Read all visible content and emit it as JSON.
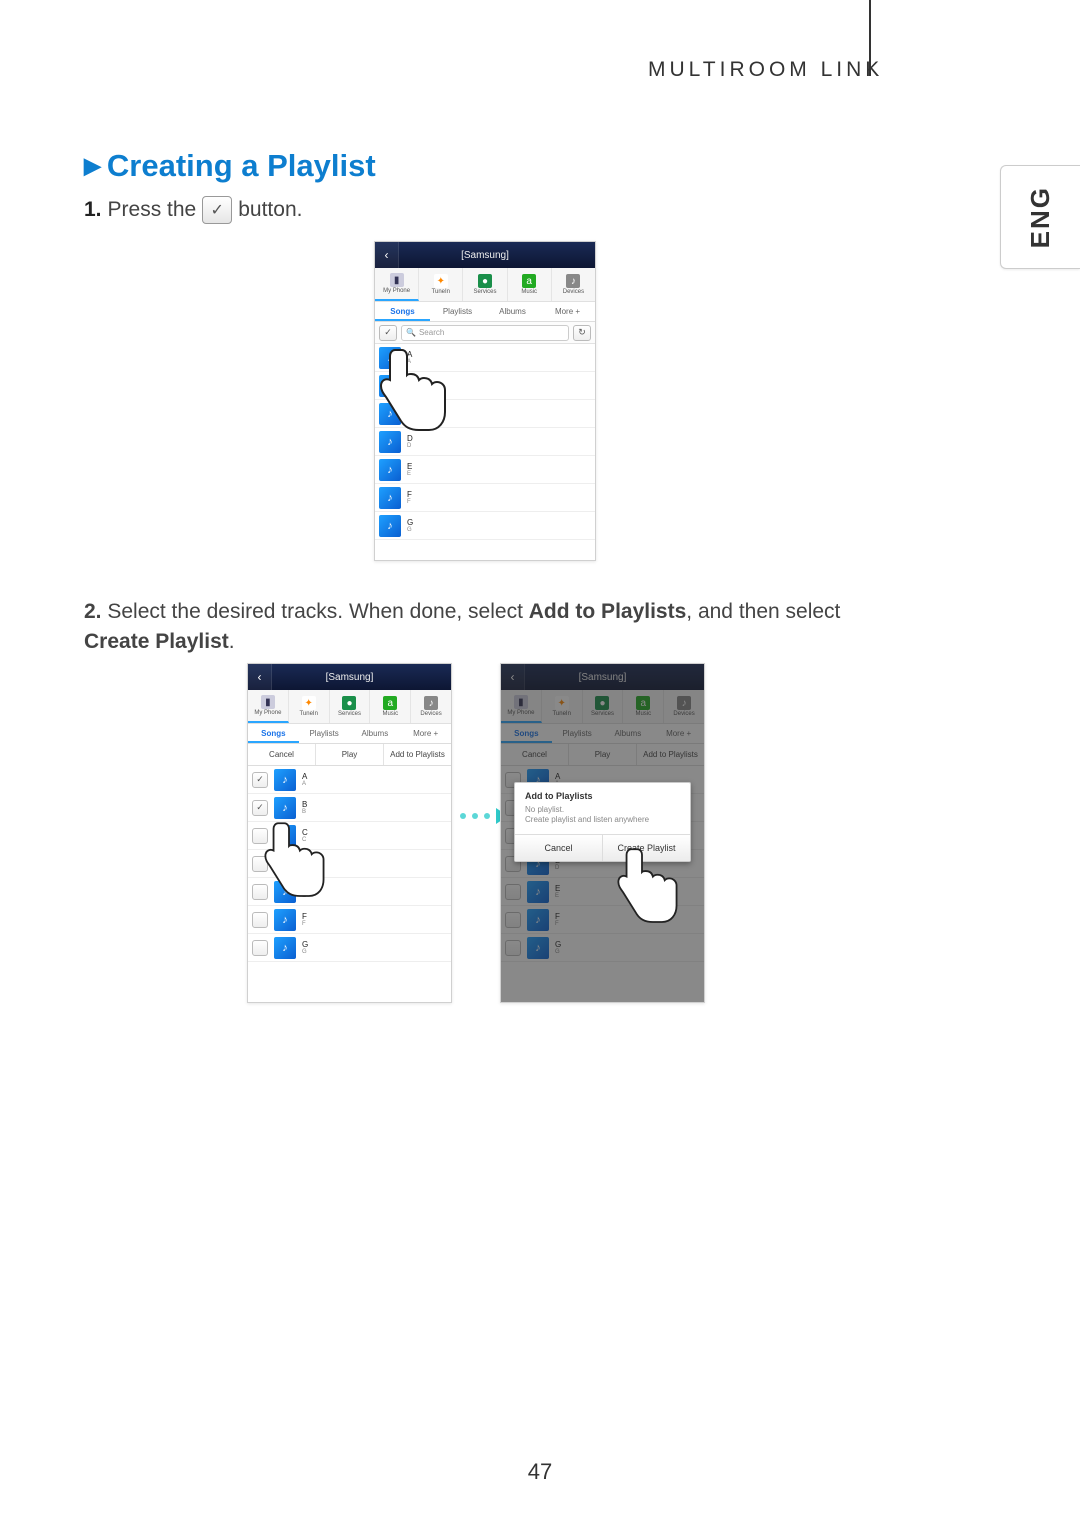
{
  "header": {
    "section": "MULTIROOM LINK",
    "lang_tab": "ENG"
  },
  "h1": "Creating a Playlist",
  "step1": {
    "num": "1.",
    "pre": "Press the",
    "post": "button."
  },
  "step2": {
    "num": "2.",
    "text": "Select the desired tracks. When done, select ",
    "b1": "Add to Playlists",
    "mid": ", and then select ",
    "b2": "Create Playlist",
    "end": "."
  },
  "page_number": "47",
  "phone_common": {
    "title": "[Samsung]",
    "sources": [
      "My Phone",
      "TuneIn",
      "Services",
      "Music",
      "Devices"
    ],
    "tabs": [
      "Songs",
      "Playlists",
      "Albums",
      "More +"
    ],
    "search_placeholder": "Search"
  },
  "phone1": {
    "tracks": [
      "A",
      "A",
      "C",
      "D",
      "E",
      "F",
      "G"
    ]
  },
  "phone2": {
    "actions": [
      "Cancel",
      "Play",
      "Add to Playlists"
    ],
    "tracks": [
      "A",
      "B",
      "C",
      "D",
      "E",
      "F",
      "G"
    ],
    "checked": [
      0,
      1
    ]
  },
  "phone3": {
    "actions": [
      "Cancel",
      "Play",
      "Add to Playlists"
    ],
    "tracks": [
      "A",
      "B",
      "C",
      "D",
      "E",
      "F",
      "G"
    ],
    "dialog": {
      "title": "Add to Playlists",
      "line1": "No playlist.",
      "line2": "Create playlist and listen anywhere",
      "cancel": "Cancel",
      "create": "Create Playlist"
    }
  }
}
